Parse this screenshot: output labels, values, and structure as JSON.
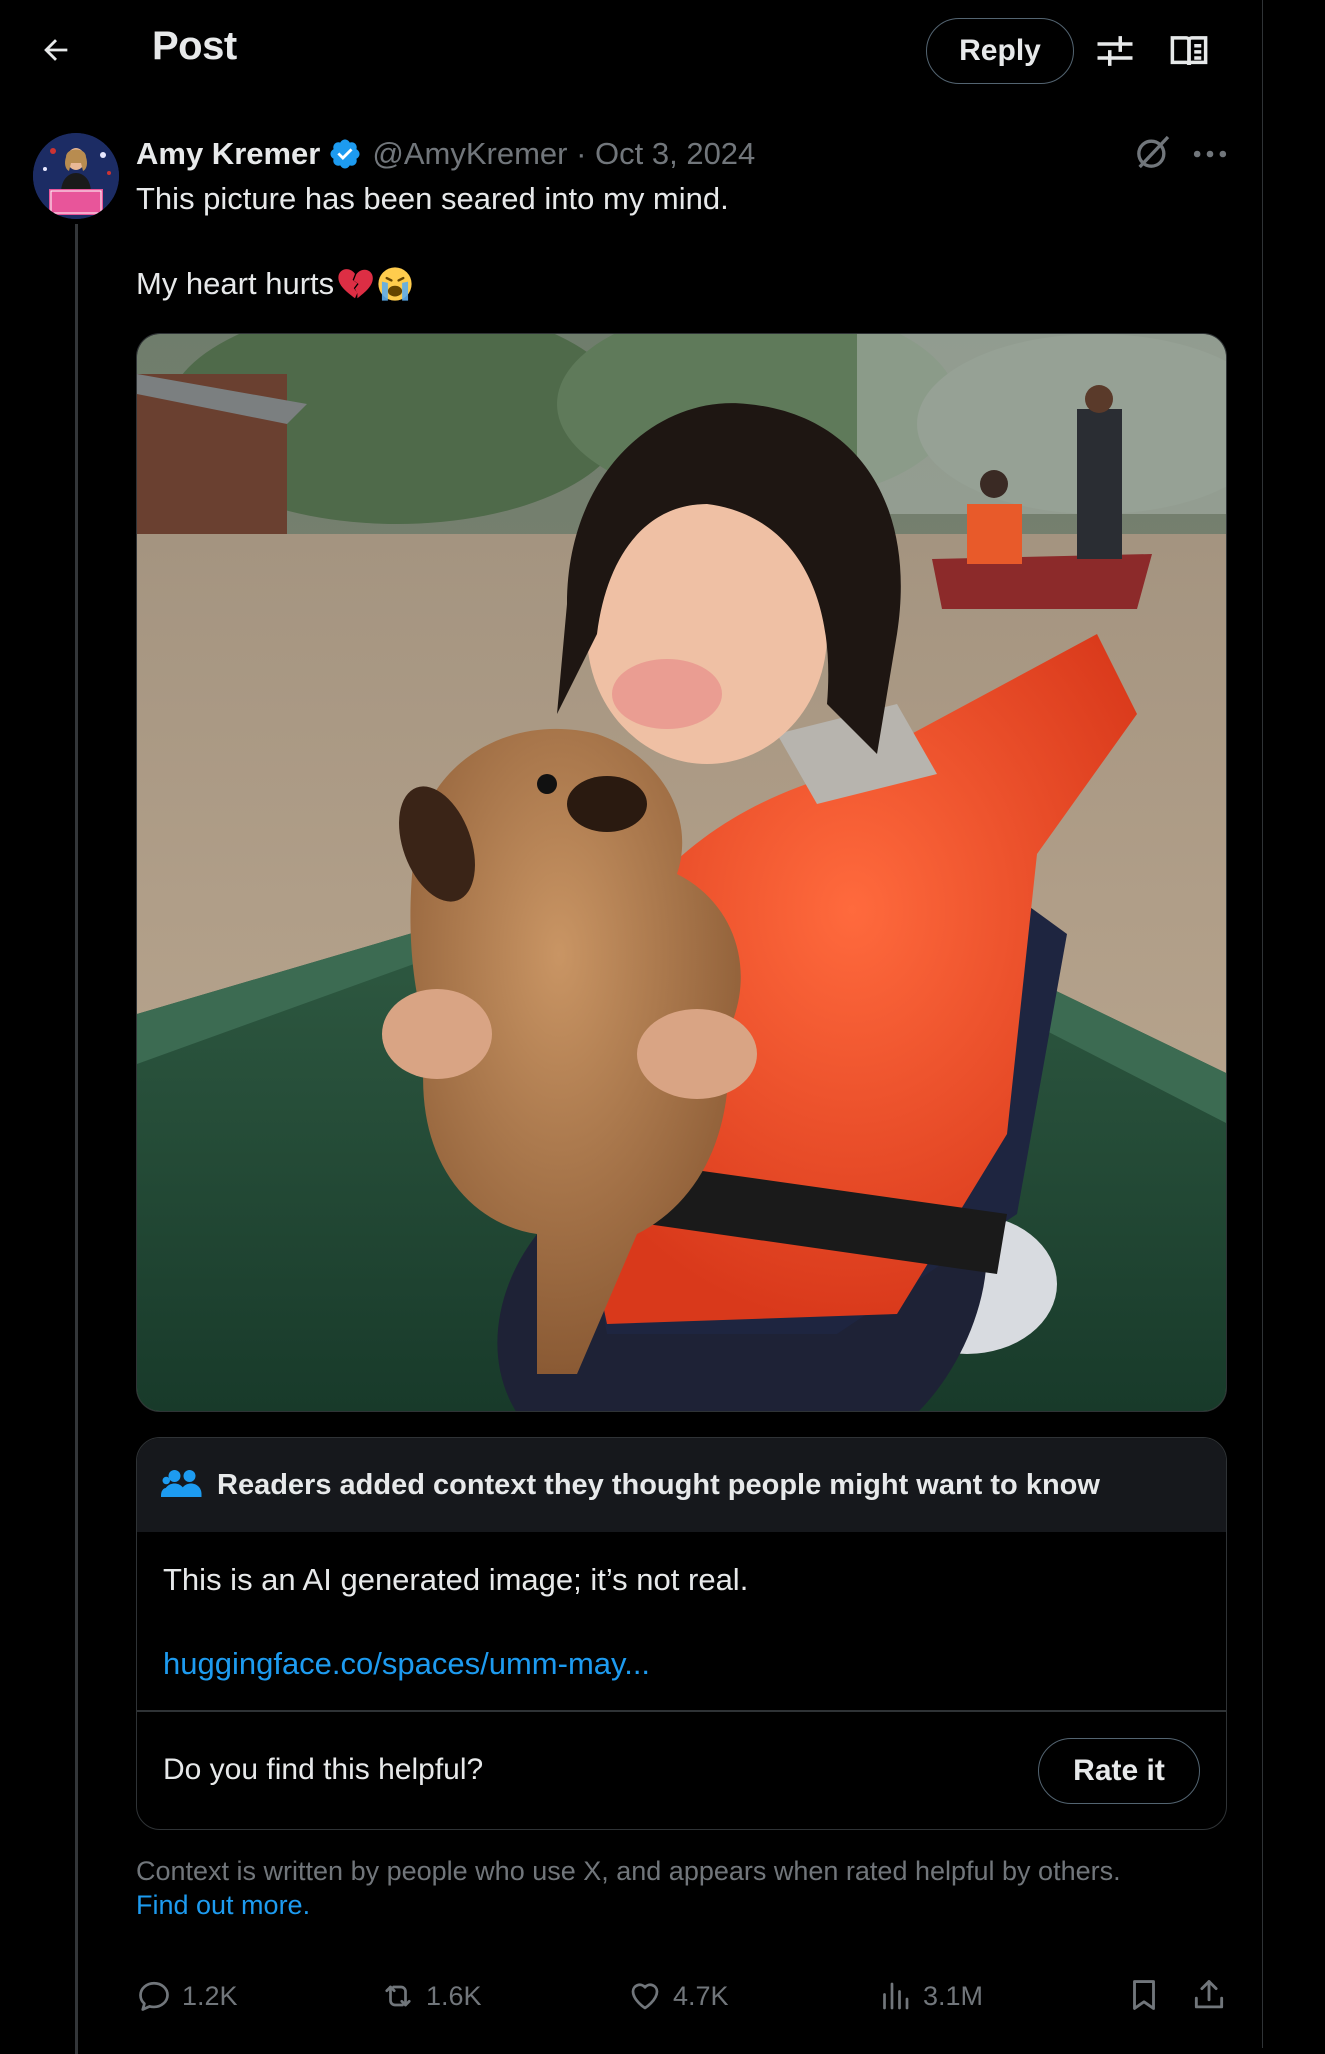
{
  "header": {
    "title": "Post",
    "reply_label": "Reply"
  },
  "post": {
    "author_name": "Amy Kremer",
    "meta": "@AmyKremer · Oct 3, 2024",
    "text_line1": "This picture has been seared into my mind.",
    "text_line2": "My heart hurts",
    "emojis": [
      "broken-heart",
      "loudly-crying-face"
    ],
    "avatar_caption": "Women TRUMP"
  },
  "community_note": {
    "header": "Readers added context they thought people might want to know",
    "body": "This is an AI generated image; it’s not real.",
    "link": "huggingface.co/spaces/umm-may...",
    "question": "Do you find this helpful?",
    "rate_label": "Rate it"
  },
  "context_footer": {
    "text": "Context is written by people who use X, and appears when rated helpful by others.",
    "link": "Find out more."
  },
  "actions": {
    "replies": "1.2K",
    "reposts": "1.6K",
    "likes": "4.7K",
    "views": "3.1M"
  },
  "colors": {
    "background": "#000000",
    "accent": "#1d9bf0",
    "muted": "#71767b",
    "note_header_bg": "#16181c"
  }
}
